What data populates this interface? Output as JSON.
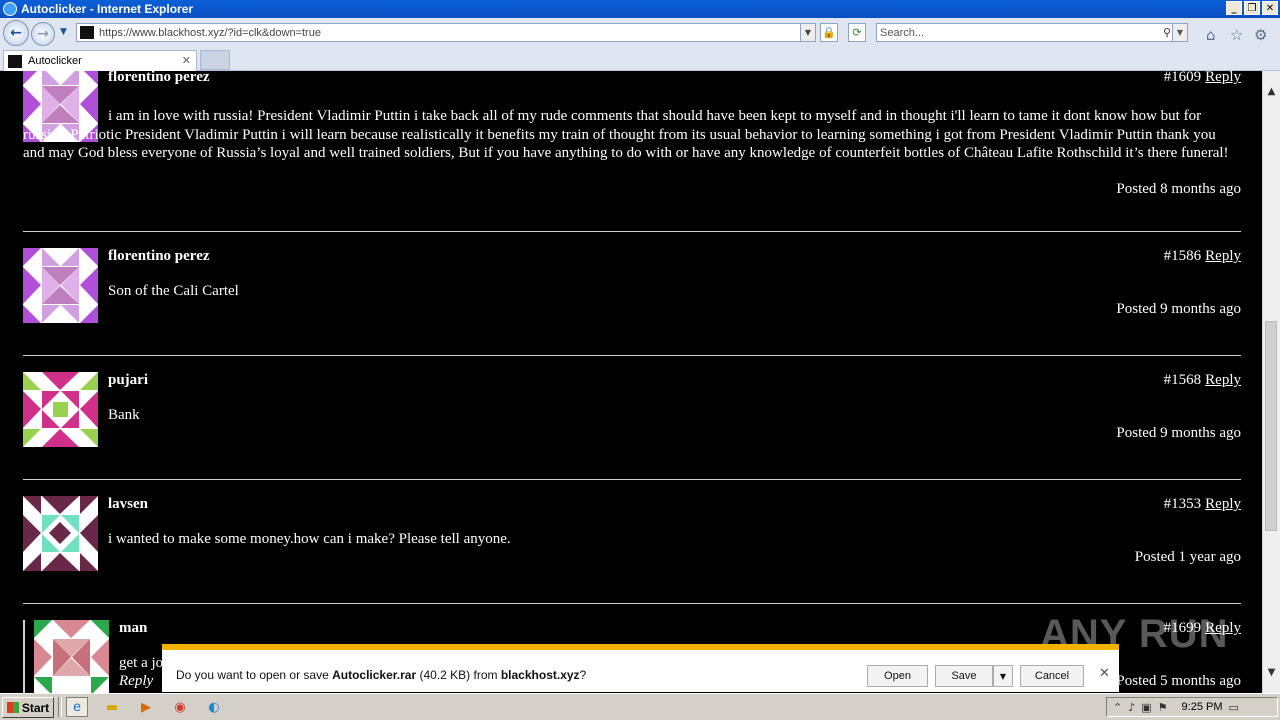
{
  "window": {
    "title": "Autoclicker - Internet Explorer"
  },
  "address": {
    "url": "https://www.blackhost.xyz/?id=clk&down=true"
  },
  "search": {
    "placeholder": "Search..."
  },
  "tab": {
    "label": "Autoclicker"
  },
  "comments": [
    {
      "name": "florentino perez",
      "id": "#1609",
      "reply": "Reply",
      "text": "i am in love with russia! President Vladimir Puttin i take back all of my rude comments that should have been kept to myself and in thought i'll learn to tame it dont know how but for russia's Patriotic President Vladimir Puttin i will learn because realistically it benefits my train of thought from its usual behavior to learning something i got from President Vladimir Puttin thank you and may God bless everyone of Russia’s loyal and well trained soldiers, But if you have anything to do with or have any knowledge of counterfeit bottles of Château Lafite Rothschild it’s there funeral!",
      "posted": "Posted 8 months ago"
    },
    {
      "name": "florentino perez",
      "id": "#1586",
      "reply": "Reply",
      "text": "Son of the Cali Cartel",
      "posted": "Posted 9 months ago"
    },
    {
      "name": "pujari",
      "id": "#1568",
      "reply": "Reply",
      "text": "Bank",
      "posted": "Posted 9 months ago"
    },
    {
      "name": "lavsen",
      "id": "#1353",
      "reply": "Reply",
      "text": "i wanted to make some money.how can i make? Please tell anyone.",
      "posted": "Posted 1 year ago"
    },
    {
      "name": "man",
      "id": "#1699",
      "reply": "Reply",
      "text": "get a jo",
      "inline_reply": "Reply",
      "posted": "Posted 5 months ago"
    }
  ],
  "download_bar": {
    "prefix": "Do you want to open or save ",
    "file": "Autoclicker.rar",
    "size": " (40.2 KB) from ",
    "host": "blackhost.xyz",
    "suffix": "?",
    "open": "Open",
    "save": "Save",
    "cancel": "Cancel"
  },
  "watermark": "ANY RUN",
  "taskbar": {
    "start": "Start",
    "time": "9:25 PM"
  },
  "colors": {
    "download_accent": "#f2b200",
    "page_bg": "#000000",
    "title_bar": "#0b5fd8"
  }
}
